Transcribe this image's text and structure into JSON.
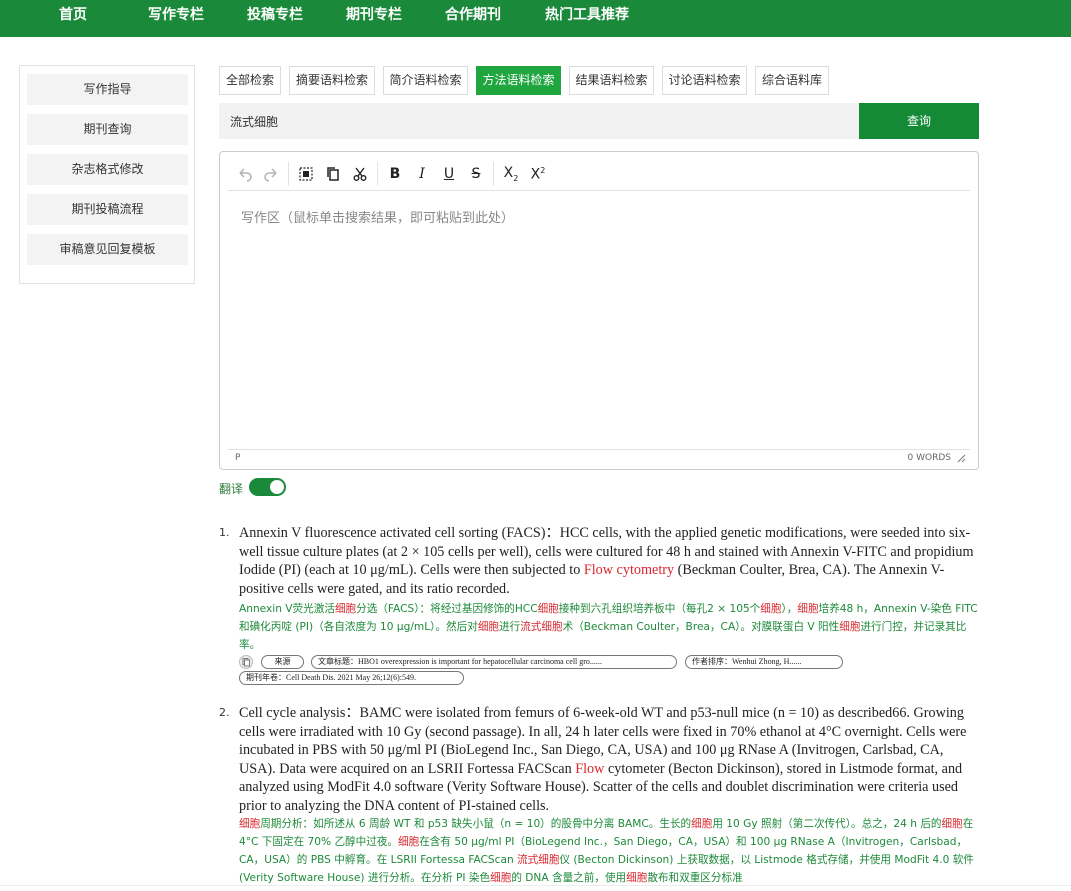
{
  "nav": {
    "items": [
      "首页",
      "写作专栏",
      "投稿专栏",
      "期刊专栏",
      "合作期刊",
      "热门工具推荐"
    ]
  },
  "sidebar": {
    "items": [
      "写作指导",
      "期刊查询",
      "杂志格式修改",
      "期刊投稿流程",
      "审稿意见回复模板"
    ]
  },
  "tabs": {
    "items": [
      "全部检索",
      "摘要语料检索",
      "简介语料检索",
      "方法语料检索",
      "结果语料检索",
      "讨论语料检索",
      "综合语料库"
    ],
    "active_index": 3
  },
  "search": {
    "value": "流式细胞",
    "button_label": "查询"
  },
  "editor": {
    "toolbar_icons": [
      "undo-icon",
      "redo-icon",
      "select-all-icon",
      "copy-icon",
      "cut-icon",
      "bold-icon",
      "italic-icon",
      "underline-icon",
      "strikethrough-icon",
      "subscript-icon",
      "superscript-icon"
    ],
    "placeholder": "写作区（鼠标单击搜索结果，即可粘贴到此处）",
    "status_path": "P",
    "word_count": "0 WORDS"
  },
  "translate": {
    "label": "翻译",
    "enabled": true
  },
  "colors": {
    "nav_bg": "#1a8a3a",
    "active_tab": "#1fa63f",
    "search_button": "#148a36",
    "highlight_red": "#d9272e",
    "translation_green": "#1e8a3a"
  },
  "results": [
    {
      "num": "1.",
      "en": {
        "before": "Annexin V fluorescence activated cell sorting (FACS)：HCC cells, with the applied genetic modifications, were seeded into six-well tissue culture plates (at 2 × 105 cells per well), cells were cultured for 48 h and stained with Annexin V-FITC and propidium Iodide (PI) (each at 10 μg/mL). Cells were then subjected to ",
        "highlight": "Flow cytometry",
        "after": " (Beckman Coulter, Brea, CA). The Annexin V-positive cells were gated, and its ratio recorded."
      },
      "zh": {
        "s1": "Annexin V荧光激活",
        "h1": "细胞",
        "s2": "分选（FACS）：将经过基因修饰的HCC",
        "h2": "细胞",
        "s3": "接种到六孔组织培养板中（每孔2 × 105个",
        "h3": "细胞",
        "s4": "），",
        "h4": "细胞",
        "s5": "培养48 h，Annexin V-染色 FITC 和碘化丙啶 (PI)（各自浓度为 10 μg/mL）。然后对",
        "h5": "细胞",
        "s6": "进行",
        "h6": "流式细胞",
        "s7": "术（Beckman Coulter，Brea，CA）。对膜联蛋白 V 阳性",
        "h7": "细胞",
        "s8": "进行门控，并记录其比率。"
      },
      "meta": {
        "source_label": "来源",
        "title_label": "文章标题：",
        "title_value": "HBO1 overexpression is important for hepatocellular carcinoma cell gro......",
        "author_label": "作者排序：",
        "author_value": "Wenhui Zhong, H......",
        "journal_label": "期刊年卷：",
        "journal_value": "Cell Death Dis. 2021 May 26;12(6):549."
      }
    },
    {
      "num": "2.",
      "en": {
        "before": "Cell cycle analysis：BAMC were isolated from femurs of 6-week-old WT and p53-null mice (n = 10) as described66. Growing cells were irradiated with 10 Gy (second passage). In all, 24 h later cells were fixed in 70% ethanol at 4°C overnight. Cells were incubated in PBS with 50 μg/ml PI (BioLegend Inc., San Diego, CA, USA) and 100 μg RNase A (Invitrogen, Carlsbad, CA, USA). Data were acquired on an LSRII Fortessa FACScan ",
        "highlight": "Flow",
        "after": " cytometer (Becton Dickinson), stored in Listmode format, and analyzed using ModFit 4.0 software (Verity Software House). Scatter of the cells and doublet discrimination were criteria used prior to analyzing the DNA content of PI-stained cells."
      },
      "zh": {
        "h1": "细胞",
        "s1": "周期分析：如所述从 6 周龄 WT 和 p53 缺失小鼠（n = 10）的股骨中分离 BAMC。生长的",
        "h2": "细胞",
        "s2": "用 10 Gy 照射（第二次传代）。总之，24 h 后的",
        "h3": "细胞",
        "s3": "在 4°C 下固定在 70% 乙醇中过夜。",
        "h4": "细胞",
        "s4": "在含有 50 μg/ml PI（BioLegend Inc.，San Diego，CA，USA）和 100 μg RNase A（Invitrogen，Carlsbad，CA，USA）的 PBS 中孵育。在 LSRII Fortessa FACScan ",
        "h5": "流式细胞",
        "s5": "仪 (Becton Dickinson) 上获取数据，以 Listmode 格式存储，并使用 ModFit 4.0 软件 (Verity Software House) 进行分析。在分析 PI 染色",
        "h6": "细胞",
        "s6": "的 DNA 含量之前，使用",
        "h7": "细胞",
        "s7": "散布和双重区分标准"
      }
    }
  ]
}
